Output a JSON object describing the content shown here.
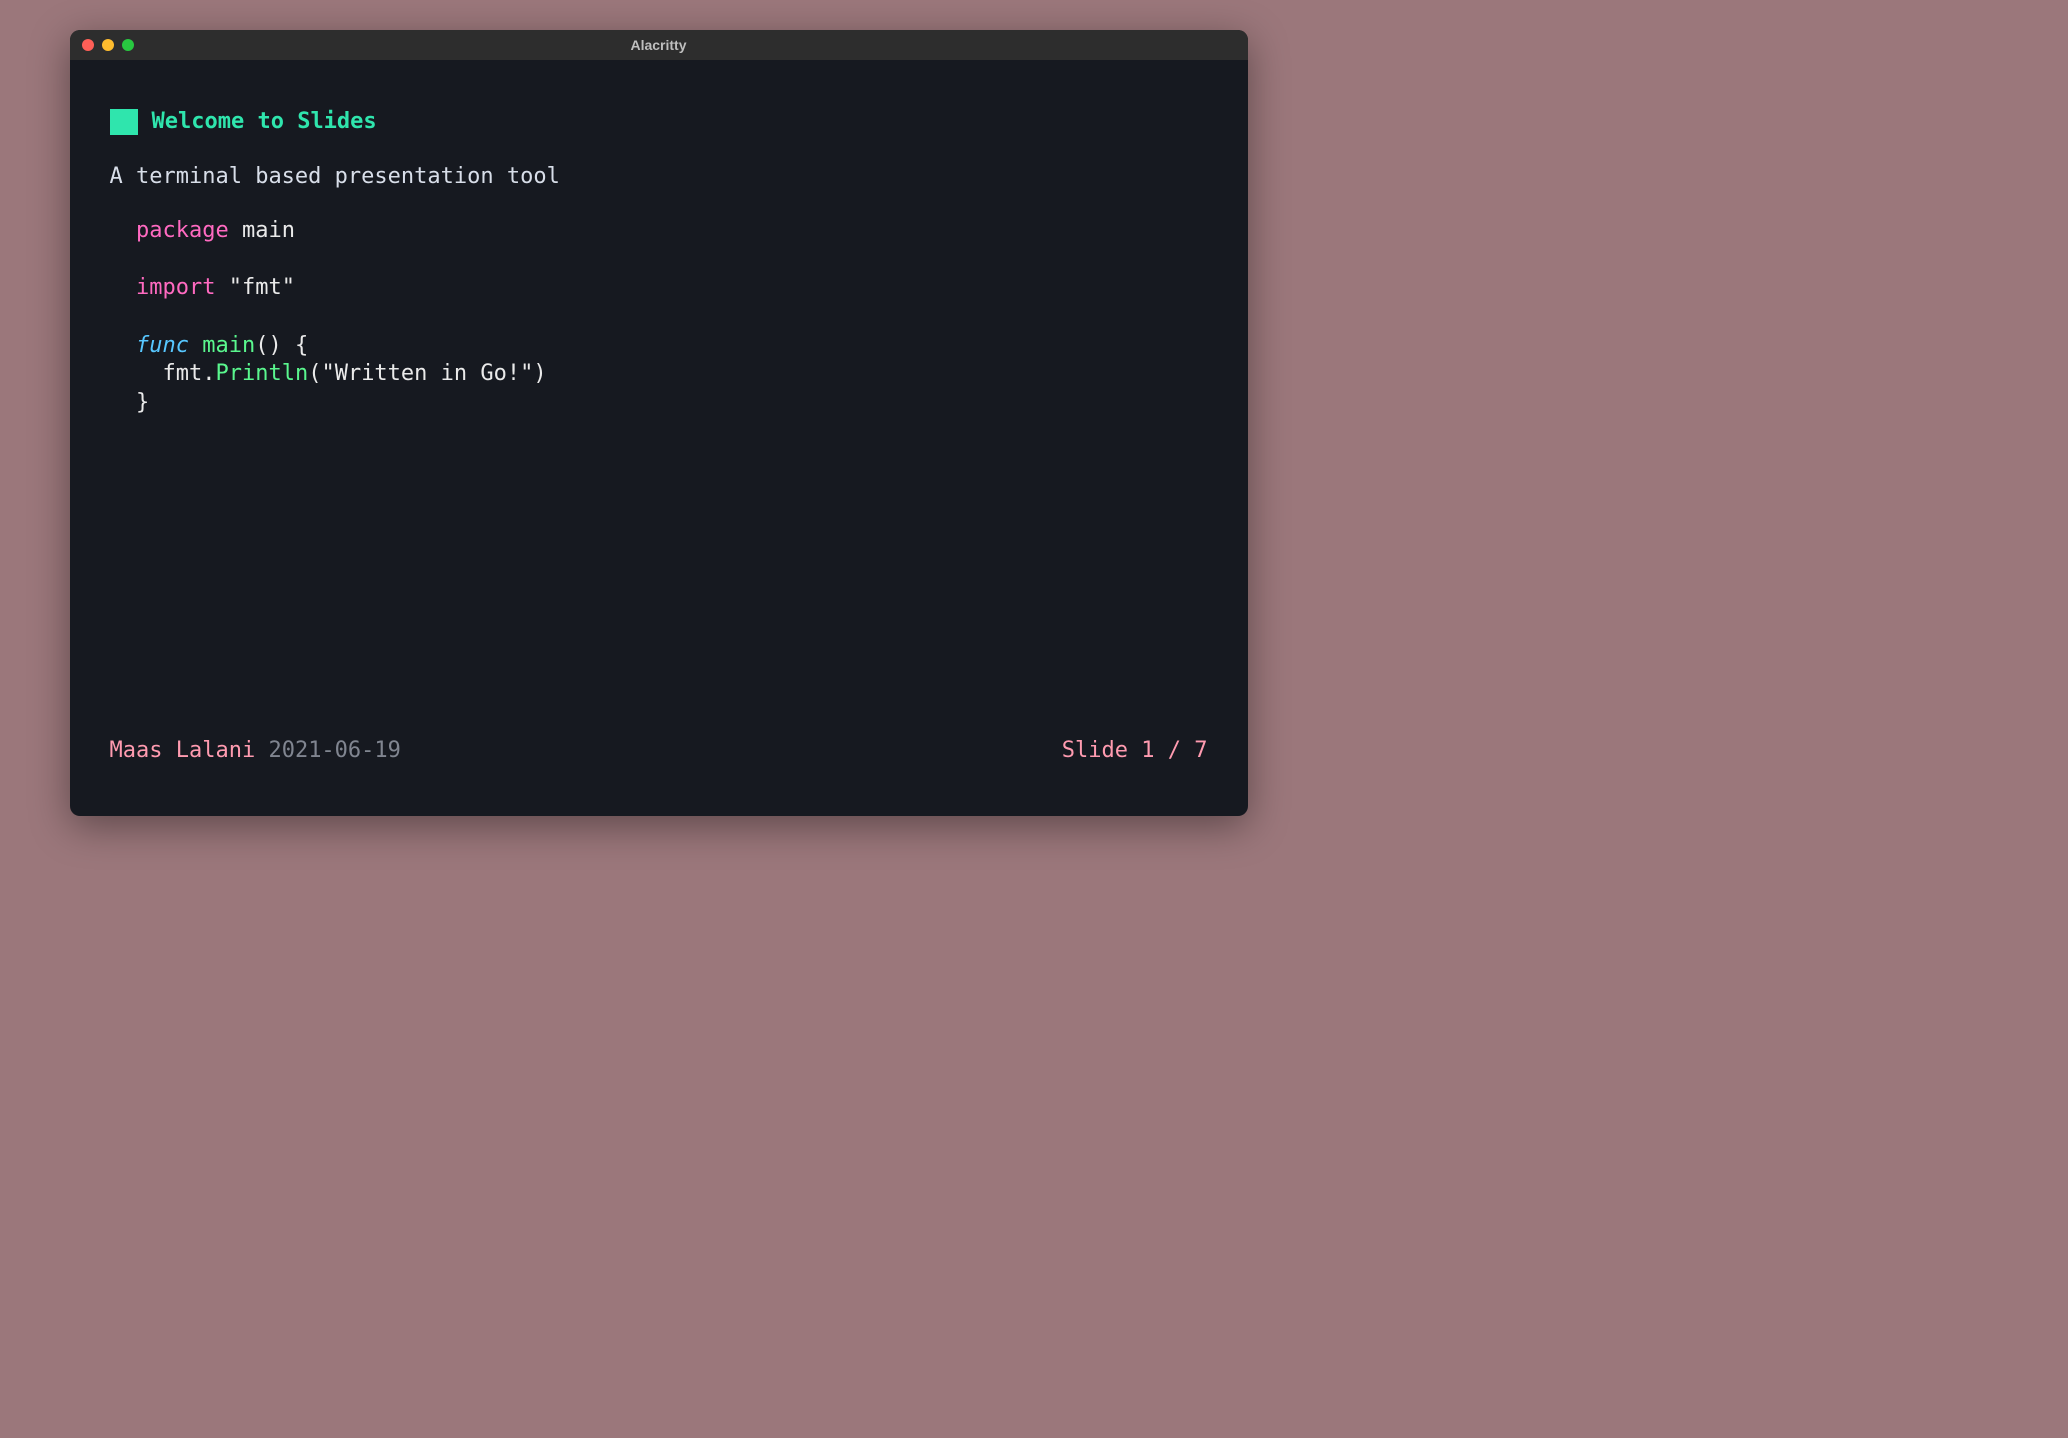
{
  "window": {
    "title": "Alacritty"
  },
  "slide": {
    "heading": "Welcome to Slides",
    "subtitle": "A terminal based presentation tool"
  },
  "code": {
    "kw_package": "package",
    "pkg_name": "main",
    "kw_import": "import",
    "import_str": "\"fmt\"",
    "kw_func": "func",
    "fn_name": "main",
    "fn_sig": "() {",
    "indent": "  ",
    "obj": "fmt",
    "dot": ".",
    "method": "Println",
    "call_open": "(",
    "arg_str": "\"Written in Go!\"",
    "call_close": ")",
    "brace_close": "}"
  },
  "status": {
    "author": "Maas Lalani",
    "date": "2021-06-19",
    "counter": "Slide 1 / 7"
  }
}
